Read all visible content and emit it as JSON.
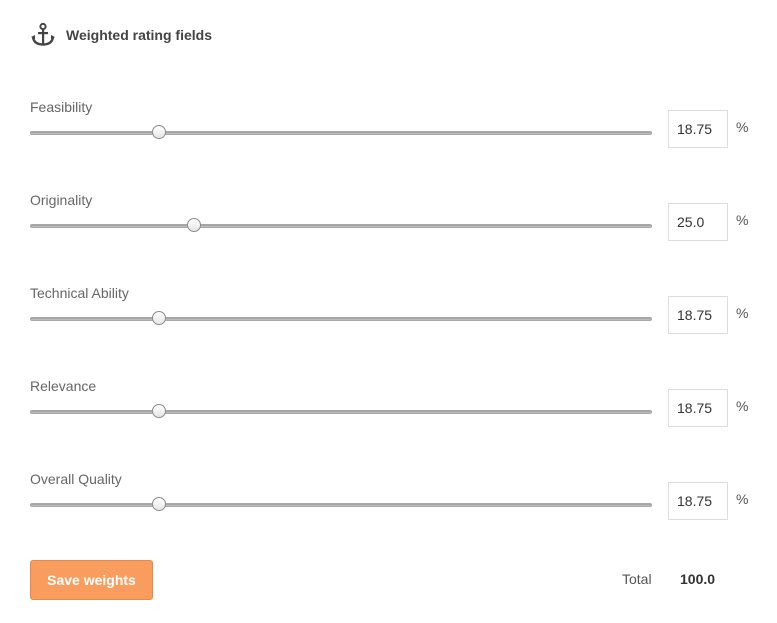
{
  "header": {
    "title": "Weighted rating fields",
    "icon": "anchor-icon"
  },
  "fields": [
    {
      "label": "Feasibility",
      "value": "18.75",
      "unit": "%",
      "slider_fraction": 0.206
    },
    {
      "label": "Originality",
      "value": "25.0",
      "unit": "%",
      "slider_fraction": 0.263
    },
    {
      "label": "Technical Ability",
      "value": "18.75",
      "unit": "%",
      "slider_fraction": 0.206
    },
    {
      "label": "Relevance",
      "value": "18.75",
      "unit": "%",
      "slider_fraction": 0.206
    },
    {
      "label": "Overall Quality",
      "value": "18.75",
      "unit": "%",
      "slider_fraction": 0.206
    }
  ],
  "actions": {
    "save_label": "Save weights"
  },
  "total": {
    "label": "Total",
    "value": "100.0"
  },
  "colors": {
    "accent": "#f99d5e",
    "text": "#555555"
  }
}
